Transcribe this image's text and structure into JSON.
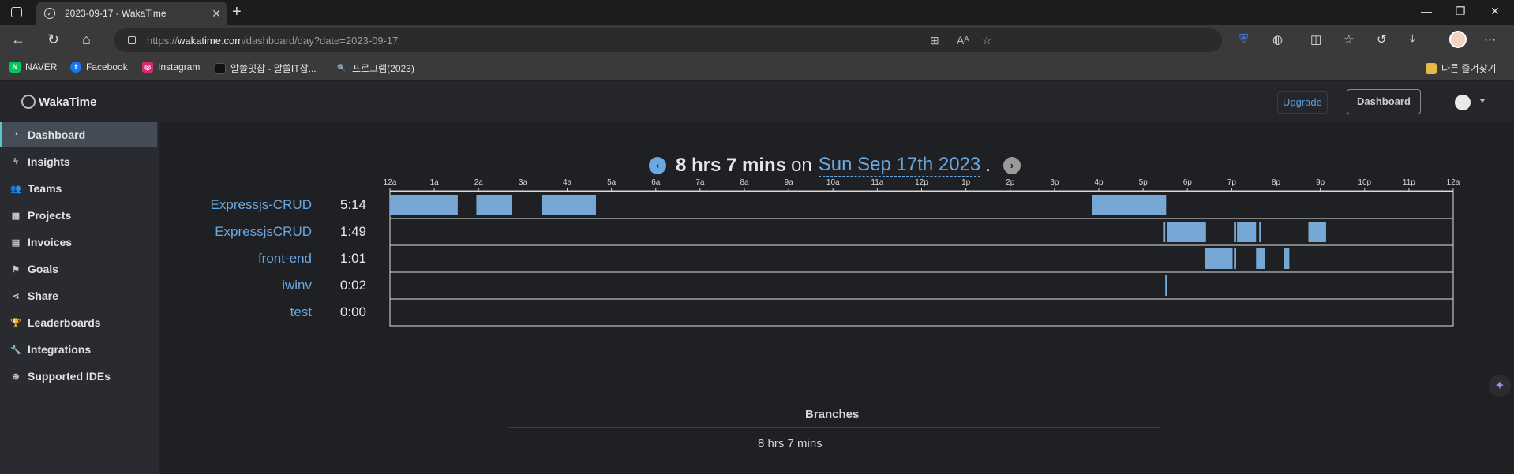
{
  "browser": {
    "tab_title": "2023-09-17 - WakaTime",
    "url_scheme": "https://",
    "url_host": "wakatime.com",
    "url_path": "/dashboard/day?date=2023-09-17",
    "bookmarks": [
      {
        "label": "NAVER",
        "icon": "naver-icon",
        "color": "#03c75a"
      },
      {
        "label": "Facebook",
        "icon": "facebook-icon",
        "color": "#1877f2"
      },
      {
        "label": "Instagram",
        "icon": "instagram-icon",
        "color": "#d62976"
      },
      {
        "label": "알쓸잇잡 - 알쓸IT잡...",
        "icon": "site-icon",
        "color": "#111111"
      },
      {
        "label": "프로그램(2023)",
        "icon": "search-icon",
        "color": "#3a3a3a"
      }
    ],
    "other_bookmarks": "다른 즐겨찾기"
  },
  "app": {
    "logo": "WakaTime",
    "upgrade_label": "Upgrade",
    "dashboard_label": "Dashboard"
  },
  "sidebar": {
    "items": [
      {
        "label": "Dashboard",
        "icon": "dashboard-icon",
        "glyph": "◔",
        "active": true
      },
      {
        "label": "Insights",
        "icon": "bolt-icon",
        "glyph": "ϟ"
      },
      {
        "label": "Teams",
        "icon": "users-icon",
        "glyph": "👥"
      },
      {
        "label": "Projects",
        "icon": "grid-icon",
        "glyph": "▦"
      },
      {
        "label": "Invoices",
        "icon": "file-icon",
        "glyph": "▤"
      },
      {
        "label": "Goals",
        "icon": "flag-icon",
        "glyph": "⚑"
      },
      {
        "label": "Share",
        "icon": "share-icon",
        "glyph": "⋖"
      },
      {
        "label": "Leaderboards",
        "icon": "trophy-icon",
        "glyph": "🏆"
      },
      {
        "label": "Integrations",
        "icon": "wrench-icon",
        "glyph": "🔧"
      },
      {
        "label": "Supported IDEs",
        "icon": "plus-circle-icon",
        "glyph": "⊕"
      }
    ]
  },
  "summary": {
    "total": "8 hrs 7 mins",
    "on": "on",
    "date": "Sun Sep 17th 2023",
    "period": "."
  },
  "chart_data": {
    "type": "timeline",
    "x_ticks": [
      "12a",
      "1a",
      "2a",
      "3a",
      "4a",
      "5a",
      "6a",
      "7a",
      "8a",
      "9a",
      "10a",
      "11a",
      "12p",
      "1p",
      "2p",
      "3p",
      "4p",
      "5p",
      "6p",
      "7p",
      "8p",
      "9p",
      "10p",
      "11p",
      "12a"
    ],
    "x_range_hours": [
      0,
      24
    ],
    "bar_color": "#77a7d4",
    "projects": [
      {
        "name": "Expressjs-CRUD",
        "duration": "5:14",
        "segments": [
          [
            0.0,
            1.53
          ],
          [
            1.95,
            2.75
          ],
          [
            3.42,
            4.65
          ],
          [
            15.85,
            17.52
          ]
        ]
      },
      {
        "name": "ExpressjsCRUD",
        "duration": "1:49",
        "segments": [
          [
            17.45,
            17.5
          ],
          [
            17.55,
            18.4
          ],
          [
            18.05,
            18.42
          ],
          [
            19.05,
            19.1
          ],
          [
            19.12,
            19.55
          ],
          [
            19.62,
            19.65
          ],
          [
            20.73,
            21.13
          ]
        ]
      },
      {
        "name": "front-end",
        "duration": "1:01",
        "segments": [
          [
            18.4,
            19.02
          ],
          [
            19.05,
            19.1
          ],
          [
            19.55,
            19.75
          ],
          [
            20.17,
            20.3
          ]
        ]
      },
      {
        "name": "iwinv",
        "duration": "0:02",
        "segments": [
          [
            17.5,
            17.53
          ]
        ]
      },
      {
        "name": "test",
        "duration": "0:00",
        "segments": []
      }
    ]
  },
  "branches": {
    "title": "Branches",
    "value": "8 hrs 7 mins"
  }
}
